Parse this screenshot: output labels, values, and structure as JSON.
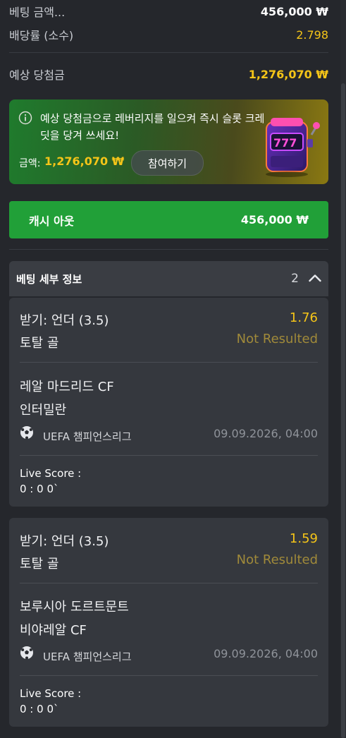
{
  "summary": {
    "bet_amount_label": "베팅 금액...",
    "bet_amount_value": "456,000 ₩",
    "odds_label": "배당률 (소수)",
    "odds_value": "2.798",
    "expected_label": "예상 당첨금",
    "expected_value": "1,276,070 ₩"
  },
  "promo": {
    "message": "예상 당첨금으로 레버리지를 일으켜 즉시 슬롯 크레딧을 당겨 쓰세요!",
    "amount_label": "금액:",
    "amount_value": "1,276,070 ₩",
    "join_label": "참여하기"
  },
  "cashout": {
    "label": "캐시 아웃",
    "value": "456,000 ₩"
  },
  "details": {
    "title": "베팅 세부 정보",
    "count": "2"
  },
  "bets": [
    {
      "market": "받기: 언더 (3.5)",
      "odds": "1.76",
      "type": "토탈 골",
      "status": "Not Resulted",
      "team_home": "레알 마드리드 CF",
      "team_away": "인터밀란",
      "league": "UEFA 챔피언스리그",
      "datetime": "09.09.2026, 04:00",
      "live_label": "Live Score :",
      "live_value": "0 : 0 0`"
    },
    {
      "market": "받기: 언더 (3.5)",
      "odds": "1.59",
      "type": "토탈 골",
      "status": "Not Resulted",
      "team_home": "보루시아 도르트문트",
      "team_away": "비야레알 CF",
      "league": "UEFA 챔피언스리그",
      "datetime": "09.09.2026, 04:00",
      "live_label": "Live Score :",
      "live_value": "0 : 0 0`"
    }
  ],
  "colors": {
    "background": "#25272c",
    "accent_yellow": "#f5c518",
    "cashout_green": "#21a038",
    "card": "#35383e"
  },
  "icons": {
    "info": "info-icon",
    "slot": "slot-machine-icon",
    "chevron": "chevron-up-icon",
    "league": "soccer-ball-icon"
  }
}
